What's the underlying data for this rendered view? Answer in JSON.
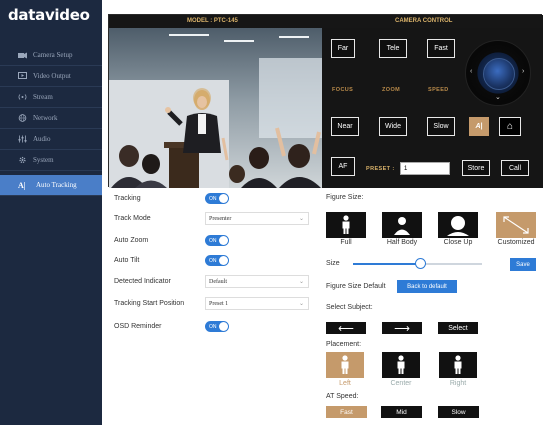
{
  "brand": {
    "logo": "datavideo"
  },
  "sidebar": {
    "items": [
      {
        "label": "Camera Setup",
        "icon": "camera-icon"
      },
      {
        "label": "Video Output",
        "icon": "monitor-icon"
      },
      {
        "label": "Stream",
        "icon": "broadcast-icon"
      },
      {
        "label": "Network",
        "icon": "globe-icon"
      },
      {
        "label": "Audio",
        "icon": "audio-mixer-icon"
      },
      {
        "label": "System",
        "icon": "gear-icon"
      },
      {
        "label": "Auto Tracking",
        "icon": "auto-tracking-icon",
        "active": true
      }
    ]
  },
  "camera": {
    "model_label": "MODEL : PTC-145",
    "control_label": "CAMERA CONTROL",
    "buttons": {
      "far": "Far",
      "tele": "Tele",
      "fast": "Fast",
      "near": "Near",
      "wide": "Wide",
      "slow": "Slow",
      "af": "AF",
      "store": "Store",
      "call": "Call"
    },
    "labels": {
      "focus": "FOCUS",
      "zoom": "ZOOM",
      "speed": "SPEED",
      "preset": "PRESET :"
    },
    "preset_value": "1",
    "joystick_arrows": {
      "left": "‹",
      "right": "›",
      "down": "⌄"
    },
    "at_button_glyph": "A|",
    "home_glyph": "⌂"
  },
  "settings": {
    "tracking_label": "Tracking",
    "tracking_state": "ON",
    "track_mode_label": "Track Mode",
    "track_mode_value": "Presenter",
    "auto_zoom_label": "Auto Zoom",
    "auto_zoom_state": "ON",
    "auto_tilt_label": "Auto Tilt",
    "auto_tilt_state": "ON",
    "detected_indicator_label": "Detected Indicator",
    "detected_indicator_value": "Default",
    "tracking_start_label": "Tracking Start Position",
    "tracking_start_value": "Preset 1",
    "osd_label": "OSD Reminder",
    "osd_state": "ON"
  },
  "figure": {
    "title": "Figure Size:",
    "options": [
      "Full",
      "Half Body",
      "Close Up",
      "Customized"
    ],
    "selected": "Customized",
    "size_label": "Size",
    "size_fraction": 0.52,
    "save_label": "Save",
    "default_label": "Figure Size Default",
    "back_label": "Back to default"
  },
  "subject": {
    "title": "Select Subject:",
    "left_glyph": "⟵",
    "right_glyph": "⟶",
    "select_label": "Select"
  },
  "placement": {
    "title": "Placement:",
    "options": [
      "Left",
      "Center",
      "Right"
    ],
    "selected": "Left"
  },
  "at_speed": {
    "title": "AT Speed:",
    "options": [
      "Fast",
      "Mid",
      "Slow"
    ],
    "selected": "Fast"
  },
  "colors": {
    "sidebar_bg": "#1c2940",
    "active_blue": "#4a7ec8",
    "accent_blue": "#2e7bd6",
    "gold": "#c59a6b"
  }
}
